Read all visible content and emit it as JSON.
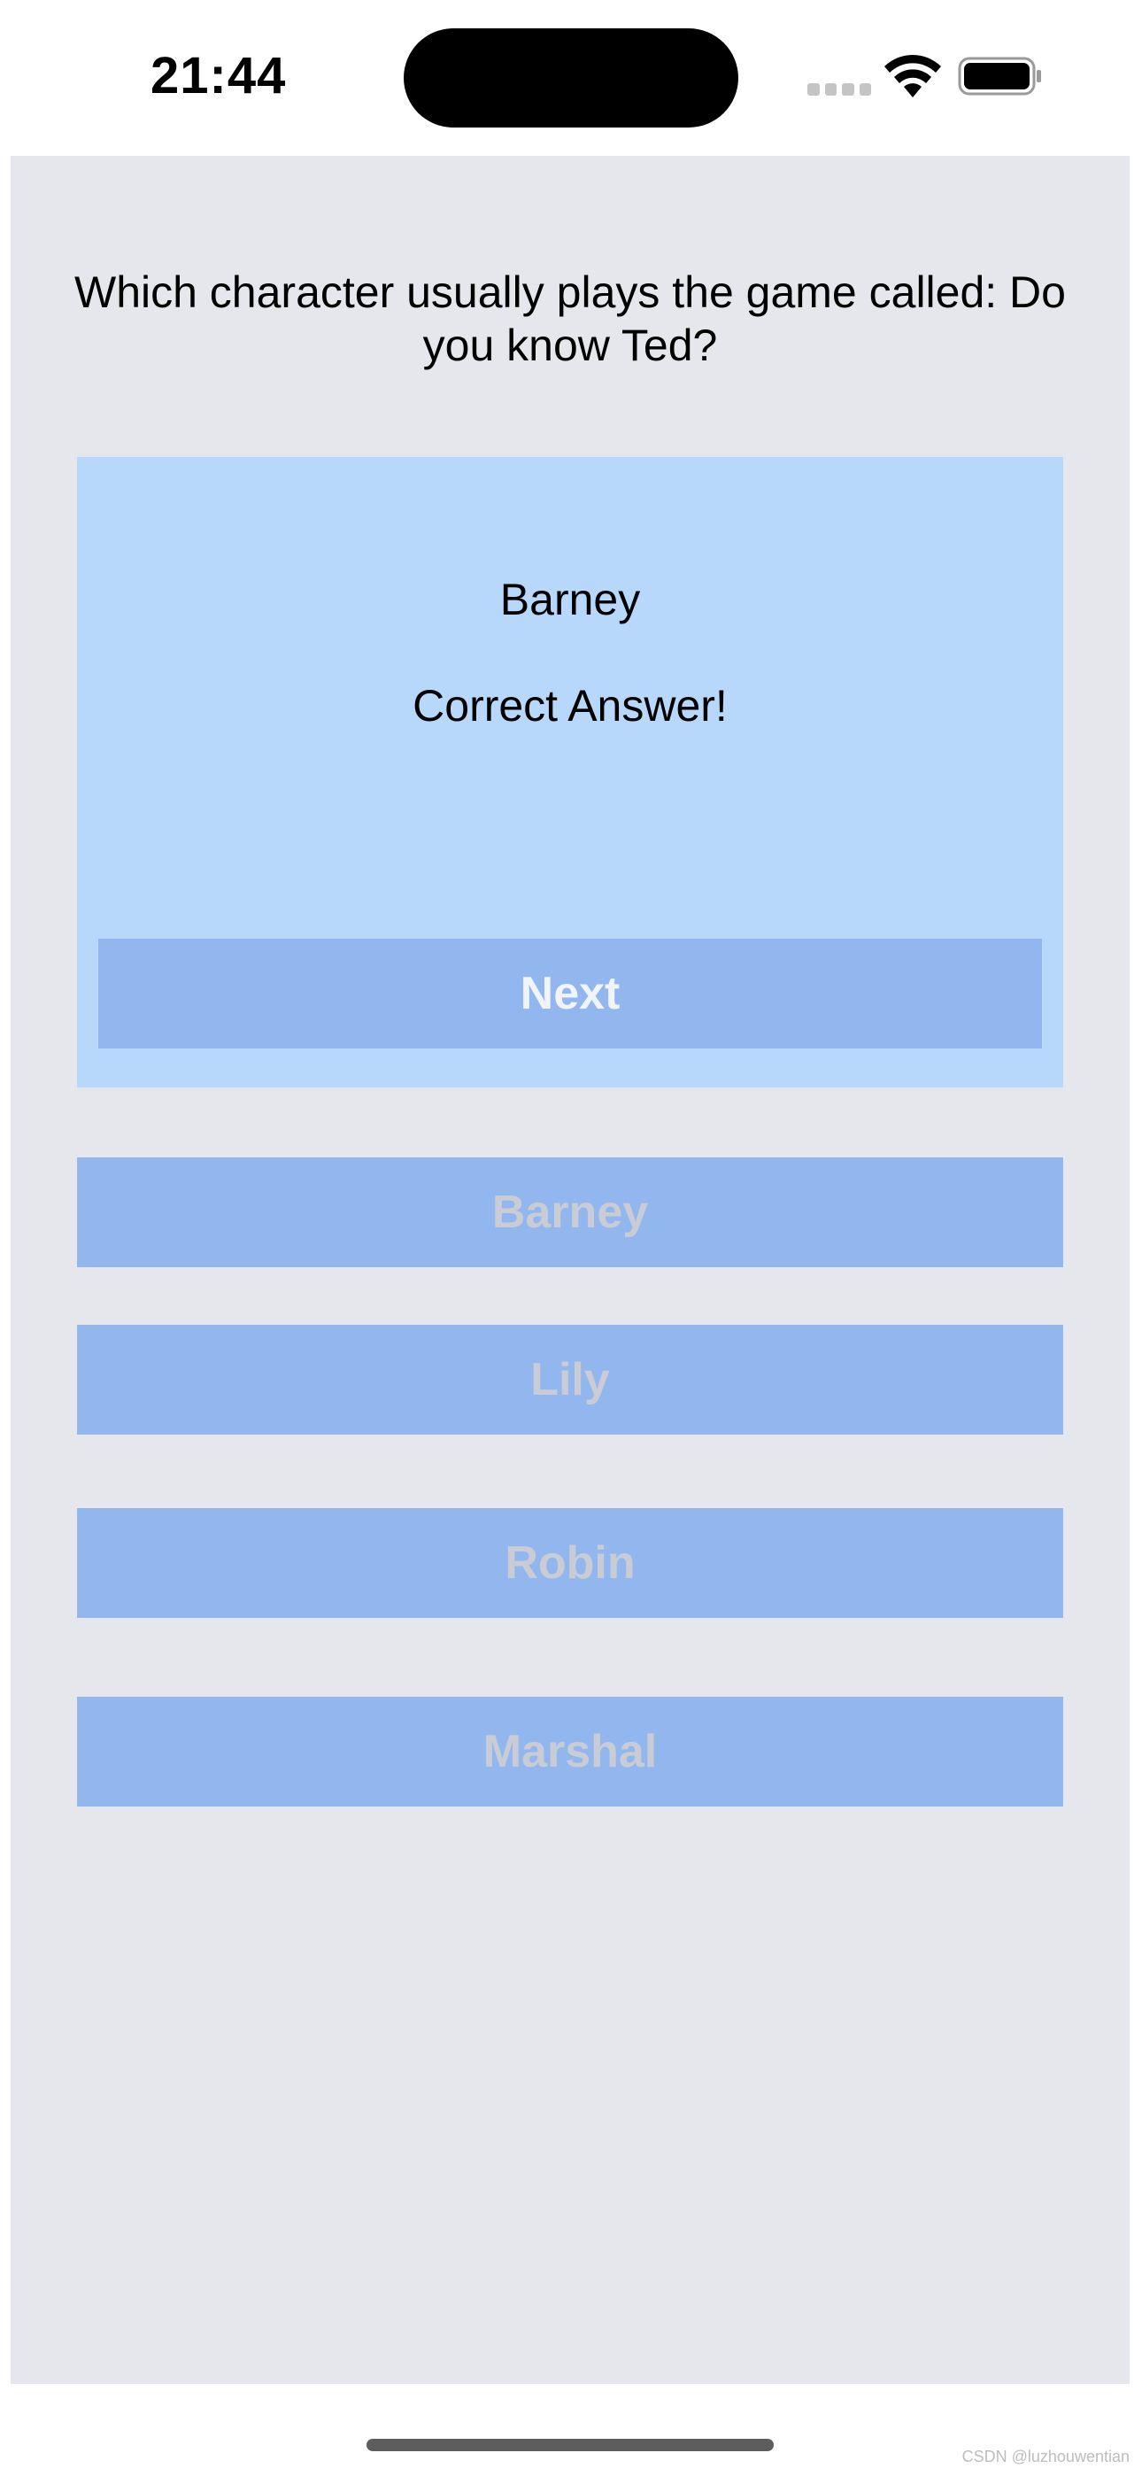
{
  "status_bar": {
    "time": "21:44",
    "icons": [
      "cellular-signal-icon",
      "wifi-icon",
      "battery-icon"
    ]
  },
  "quiz": {
    "question": "Which character usually plays the game called: Do you know Ted?",
    "selected_answer": "Barney",
    "feedback": "Correct Answer!",
    "next_label": "Next",
    "options": [
      "Barney",
      "Lily",
      "Robin",
      "Marshal"
    ]
  },
  "colors": {
    "background": "#e5e7ec",
    "answer_panel": "#b7d8fb",
    "button": "#92b6ee",
    "disabled_text": "#c9ccd5"
  },
  "watermark": "CSDN @luzhouwentian"
}
